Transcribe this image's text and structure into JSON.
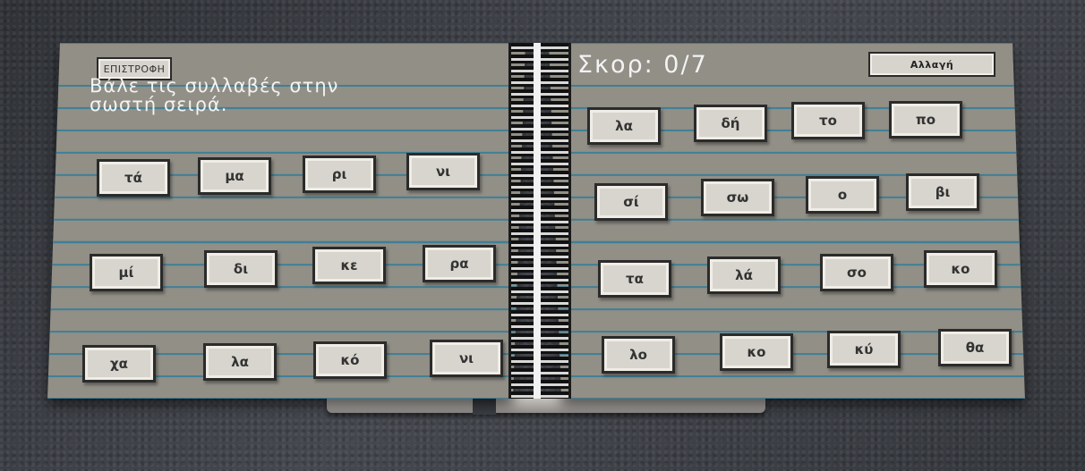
{
  "buttons": {
    "back_label": "ΕΠΙΣΤΡΟΦΗ",
    "change_label": "Αλλαγή"
  },
  "instruction": {
    "line1": "Βάλε τις συλλαβές στην",
    "line2": "σωστή σειρά."
  },
  "score": {
    "label": "Σκορ: 0/7"
  },
  "left_tiles": [
    "τά",
    "μα",
    "ρι",
    "νι",
    "μί",
    "δι",
    "κε",
    "ρα",
    "χα",
    "λα",
    "κό",
    "νι"
  ],
  "right_tiles": [
    "λα",
    "δή",
    "το",
    "πο",
    "σί",
    "σω",
    "ο",
    "βι",
    "τα",
    "λά",
    "σο",
    "κο",
    "λο",
    "κο",
    "κύ",
    "θα"
  ]
}
